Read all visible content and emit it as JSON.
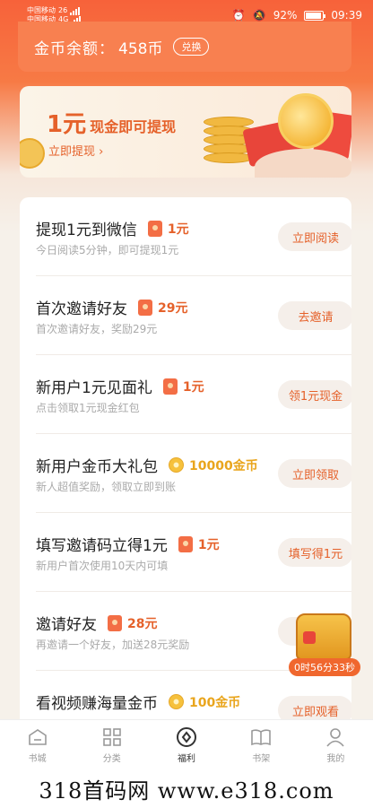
{
  "status_bar": {
    "carrier1": "中国移动",
    "carrier2": "中国移动",
    "net1": "26",
    "net2": "4G",
    "battery": "92%",
    "time": "09:39"
  },
  "coin_balance": {
    "label": "金币余额：",
    "value": "458币",
    "exchange_button": "兑换"
  },
  "banner": {
    "amount": "1元",
    "text": "现金即可提现",
    "link": "立即提现 ›"
  },
  "tasks": [
    {
      "title": "提现1元到微信",
      "reward_type": "cash",
      "reward": "1元",
      "desc": "今日阅读5分钟，即可提现1元",
      "button": "立即阅读"
    },
    {
      "title": "首次邀请好友",
      "reward_type": "cash",
      "reward": "29元",
      "desc": "首次邀请好友，奖励29元",
      "button": "去邀请"
    },
    {
      "title": "新用户1元见面礼",
      "reward_type": "cash",
      "reward": "1元",
      "desc": "点击领取1元现金红包",
      "button": "领1元现金"
    },
    {
      "title": "新用户金币大礼包",
      "reward_type": "coin",
      "reward": "10000金币",
      "desc": "新人超值奖励，领取立即到账",
      "button": "立即领取"
    },
    {
      "title": "填写邀请码立得1元",
      "reward_type": "cash",
      "reward": "1元",
      "desc": "新用户首次使用10天内可填",
      "button": "填写得1元"
    },
    {
      "title": "邀请好友",
      "reward_type": "cash",
      "reward": "28元",
      "desc": "再邀请一个好友，加送28元奖励",
      "button": "去邀"
    },
    {
      "title": "看视频赚海量金币",
      "reward_type": "coin",
      "reward": "100金币",
      "desc": "",
      "button": "立即观看"
    }
  ],
  "chest": {
    "timer": "0时56分33秒"
  },
  "tab_bar": {
    "items": [
      {
        "label": "书城",
        "icon": "bookstore-icon"
      },
      {
        "label": "分类",
        "icon": "category-icon"
      },
      {
        "label": "福利",
        "icon": "welfare-icon",
        "active": true
      },
      {
        "label": "书架",
        "icon": "bookshelf-icon"
      },
      {
        "label": "我的",
        "icon": "profile-icon"
      }
    ]
  },
  "watermark": "318首码网 www.e318.com",
  "colors": {
    "accent": "#e5612a",
    "header": "#f7623a",
    "coin_gold": "#e9a51d"
  }
}
